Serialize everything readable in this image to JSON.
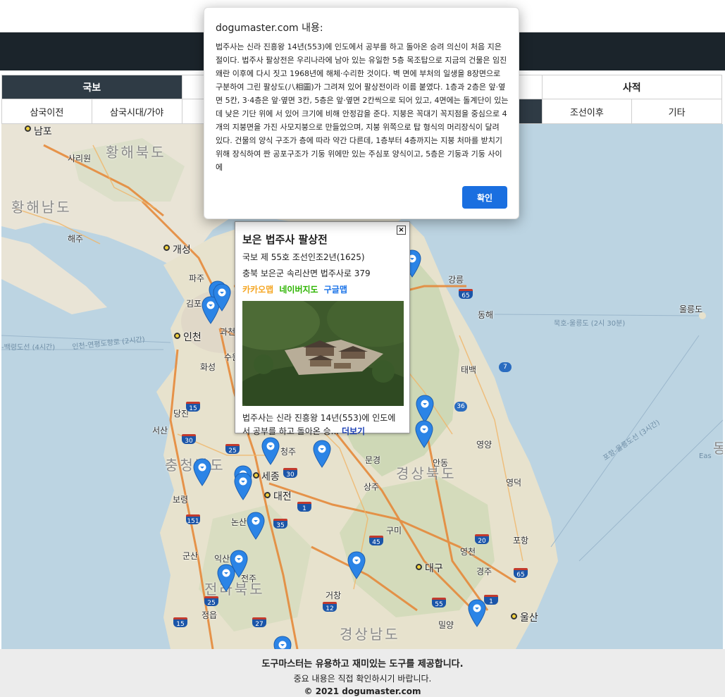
{
  "category_tabs": [
    {
      "label": "국보",
      "active": true
    },
    {
      "label": "",
      "active": false
    },
    {
      "label": "",
      "active": false
    },
    {
      "label": "사적",
      "active": false
    }
  ],
  "period_tabs": [
    {
      "label": "삼국이전",
      "active": false
    },
    {
      "label": "삼국시대/가야",
      "active": false
    },
    {
      "label": "",
      "active": false
    },
    {
      "label": "",
      "active": false
    },
    {
      "label": "",
      "active": false
    },
    {
      "label": "",
      "active": true
    },
    {
      "label": "조선이후",
      "active": false
    },
    {
      "label": "기타",
      "active": false
    }
  ],
  "map": {
    "labels": {
      "hwanghae_n": "황해북도",
      "hwanghae_s": "황해남도",
      "chungnam": "충청남도",
      "gyeongbuk": "경상북도",
      "jeonbuk": "전라북도",
      "gyeongnam": "경상남도",
      "nampo": "남포",
      "kaesong": "개성",
      "incheon": "인천",
      "sejong": "세종",
      "daejeon": "대전",
      "daegu": "대구",
      "ulsan": "울산",
      "gangneung": "강릉",
      "donghae": "동해",
      "ulleungdo": "울릉도",
      "cheongju": "청주",
      "andong": "안동",
      "sangju": "상주",
      "pohang": "포항",
      "gyeongju": "경주",
      "gunsan": "군산",
      "jeonju": "전주",
      "iksan": "익산",
      "boryeong": "보령",
      "seosan": "서산",
      "dangjin": "당진",
      "hwaseong": "화성",
      "suwon": "수원",
      "gimpo": "김포",
      "paju": "파주",
      "gwacheon": "과천",
      "sariwon": "사리원",
      "haeju": "해주",
      "yeongyang": "영양",
      "yeongdeok": "영덕",
      "taebaek": "태백",
      "mungyeong": "문경",
      "gumi": "구미",
      "yeongcheon": "영천",
      "geochang": "거창",
      "miryang": "밀양",
      "jeongeup": "정읍",
      "nonsan": "논산",
      "east_sea_short": "동",
      "east_sea_roman": "Eas",
      "ferry_ulleung": "묵호-울릉도 (2시 30분)",
      "ferry_pohang": "포항-울릉도선 (3시간)",
      "ferry_incheon": "인천-연평도항로 (2시간)",
      "ferry_baeknyeong": "-백령도선 (4시간)"
    }
  },
  "info_window": {
    "close": "×",
    "title": "보은 법주사 팔상전",
    "designation": "국보 제 55호 조선인조2년(1625)",
    "address": "충북 보은군 속리산면 법주사로 379",
    "links": {
      "kakao": "카카오맵",
      "naver": "네이버지도",
      "google": "구글맵"
    },
    "link_colors": {
      "kakao": "#f5a623",
      "naver": "#2db400",
      "google": "#1a73e8"
    },
    "summary": "법주사는 신라 진흥왕 14년(553)에 인도에서 공부를 하고 돌아온 승...",
    "more": "더보기"
  },
  "dialog": {
    "title": "dogumaster.com 내용:",
    "body": "법주사는 신라 진흥왕 14년(553)에 인도에서 공부를 하고 돌아온 승려 의신이 처음 지은 절이다. 법주사 팔상전은 우리나라에 남아 있는 유일한 5층 목조탑으로 지금의 건물은 임진왜란 이후에 다시 짓고 1968년에 해체·수리한 것이다. 벽 면에 부처의 일생을 8장면으로 구분하여 그린 팔상도(八相圖)가 그려져 있어 팔상전이라 이름 붙였다. 1층과 2층은 앞·옆면 5칸, 3·4층은 앞·옆면 3칸, 5층은 앞·옆면 2칸씩으로 되어 있고, 4면에는 돌계단이 있는데 낮은 기단 위에 서 있어 크기에 비해 안정감을 준다. 지붕은 꼭대기 꼭지점을 중심으로 4개의 지붕면을 가진 사모지붕으로 만들었으며, 지붕 위쪽으로 탑 형식의 머리장식이 달려 있다. 건물의 양식 구조가 층에 따라 약간 다른데, 1층부터 4층까지는 지붕 처마를 받치기 위해 장식하여 짠 공포구조가 기둥 위에만 있는 주심포 양식이고, 5층은 기둥과 기둥 사이에",
    "ok": "확인"
  },
  "footer": {
    "line1": "도구마스터는 유용하고 재미있는 도구를 제공합니다.",
    "line2": "중요 내용은 직접 확인하시기 바랍니다.",
    "line3": "© 2021 dogumaster.com"
  },
  "colors": {
    "navbar": "#1b242b",
    "active_tab": "#2f3b45",
    "marker": "#2b84e6",
    "ok_button": "#1a6fe0"
  }
}
